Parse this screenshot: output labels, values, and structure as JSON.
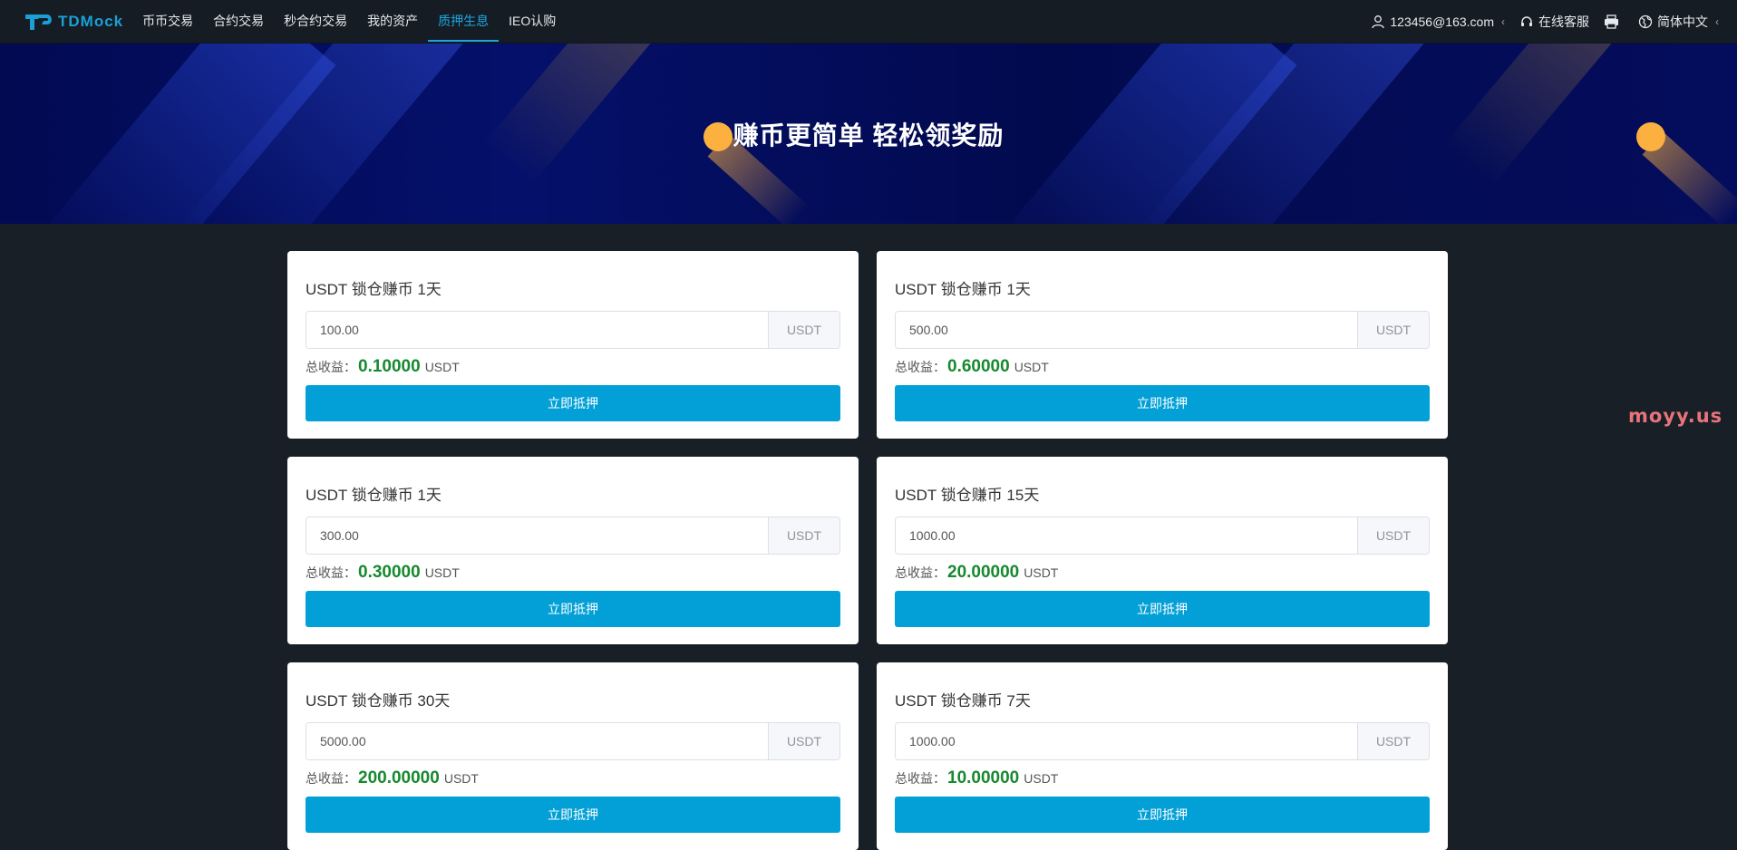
{
  "header": {
    "logo_text": "TDMock",
    "nav": [
      {
        "label": "币币交易"
      },
      {
        "label": "合约交易"
      },
      {
        "label": "秒合约交易"
      },
      {
        "label": "我的资产"
      },
      {
        "label": "质押生息"
      },
      {
        "label": "IEO认购"
      }
    ],
    "active_nav": "质押生息",
    "user": "123456@163.com",
    "support": "在线客服",
    "language": "简体中文"
  },
  "banner": {
    "title": "赚币更简单 轻松领奖励"
  },
  "cards": [
    {
      "title": "USDT 锁仓赚币 1天",
      "amount": "100.00",
      "unit": "USDT",
      "profit_label": "总收益：",
      "profit_value": "0.10000",
      "profit_unit": "USDT",
      "button": "立即抵押"
    },
    {
      "title": "USDT 锁仓赚币 1天",
      "amount": "500.00",
      "unit": "USDT",
      "profit_label": "总收益：",
      "profit_value": "0.60000",
      "profit_unit": "USDT",
      "button": "立即抵押"
    },
    {
      "title": "USDT 锁仓赚币 1天",
      "amount": "300.00",
      "unit": "USDT",
      "profit_label": "总收益：",
      "profit_value": "0.30000",
      "profit_unit": "USDT",
      "button": "立即抵押"
    },
    {
      "title": "USDT 锁仓赚币 15天",
      "amount": "1000.00",
      "unit": "USDT",
      "profit_label": "总收益：",
      "profit_value": "20.00000",
      "profit_unit": "USDT",
      "button": "立即抵押"
    },
    {
      "title": "USDT 锁仓赚币 30天",
      "amount": "5000.00",
      "unit": "USDT",
      "profit_label": "总收益：",
      "profit_value": "200.00000",
      "profit_unit": "USDT",
      "button": "立即抵押"
    },
    {
      "title": "USDT 锁仓赚币 7天",
      "amount": "1000.00",
      "unit": "USDT",
      "profit_label": "总收益：",
      "profit_value": "10.00000",
      "profit_unit": "USDT",
      "button": "立即抵押"
    }
  ],
  "watermark": "moyy.us",
  "colors": {
    "accent": "#02a0d6",
    "profit": "#17892f",
    "header_bg": "#161c24",
    "page_bg": "#181f27",
    "banner_bg": "#020a52"
  }
}
